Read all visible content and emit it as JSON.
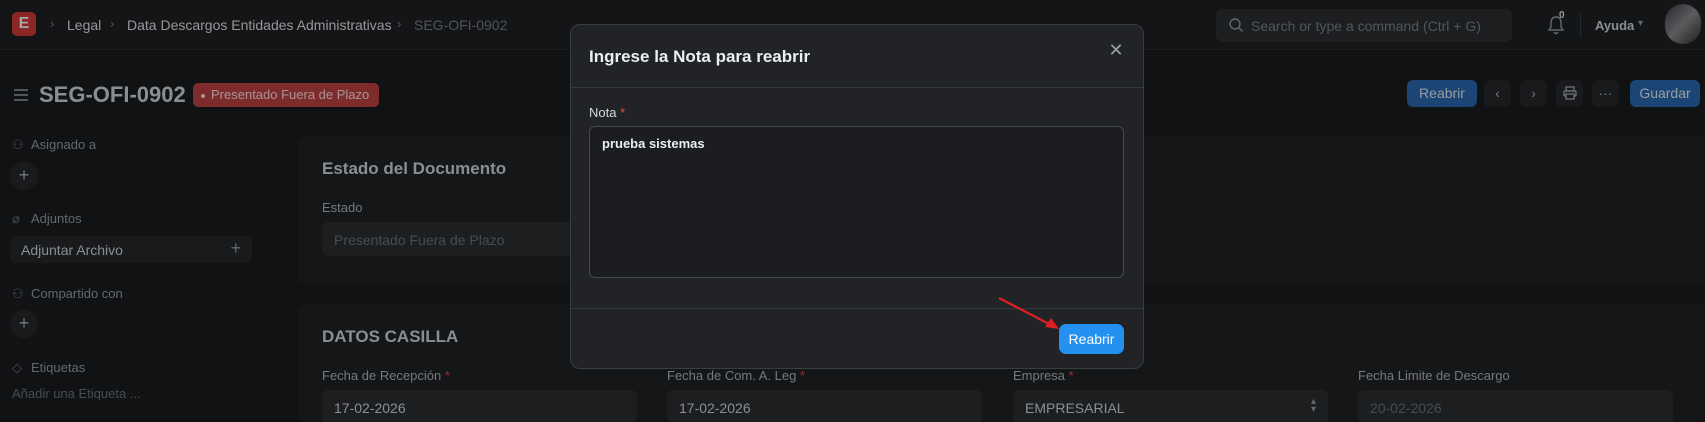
{
  "navbar": {
    "logo_letter": "E",
    "breadcrumbs": [
      "Legal",
      "Data Descargos Entidades Administrativas",
      "SEG-OFI-0902"
    ],
    "search_placeholder": "Search or type a command (Ctrl + G)",
    "notification_count": "0",
    "help_label": "Ayuda"
  },
  "header": {
    "title": "SEG-OFI-0902",
    "status": "Presentado Fuera de Plazo",
    "status_color": "#c24242",
    "reopen_label": "Reabrir",
    "save_label": "Guardar",
    "more_label": "···"
  },
  "sidebar": {
    "assigned_label": "Asignado a",
    "attachments_label": "Adjuntos",
    "attach_button": "Adjuntar Archivo",
    "shared_label": "Compartido con",
    "tags_label": "Etiquetas",
    "add_tag": "Añadir una Etiqueta ..."
  },
  "document_status": {
    "section_title": "Estado del Documento",
    "estado_label": "Estado",
    "estado_value": "Presentado Fuera de Plazo"
  },
  "datos_casilla": {
    "section_title": "DATOS CASILLA",
    "fields": [
      {
        "label": "Fecha de Recepción",
        "required": "*",
        "value": "17-02-2026"
      },
      {
        "label": "Fecha de Com. A. Leg",
        "required": "*",
        "value": "17-02-2026"
      },
      {
        "label": "Empresa",
        "required": "*",
        "value": "EMPRESARIAL"
      },
      {
        "label": "Fecha Limite de Descargo",
        "required": "",
        "value": "20-02-2026"
      }
    ]
  },
  "modal": {
    "title": "Ingrese la Nota para reabrir",
    "field_label": "Nota",
    "required": "*",
    "field_value": "prueba sistemas",
    "primary_button": "Reabrir",
    "primary_color": "#2490ef"
  }
}
